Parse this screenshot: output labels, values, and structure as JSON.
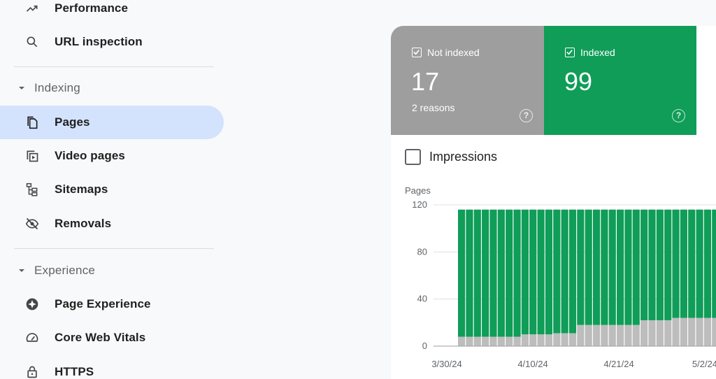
{
  "sidebar": {
    "items": [
      {
        "label": "Performance",
        "icon": "trending-up-icon"
      },
      {
        "label": "URL inspection",
        "icon": "search-icon"
      }
    ],
    "sections": [
      {
        "label": "Indexing",
        "items": [
          {
            "label": "Pages",
            "icon": "pages-icon",
            "active": true
          },
          {
            "label": "Video pages",
            "icon": "video-pages-icon"
          },
          {
            "label": "Sitemaps",
            "icon": "sitemap-icon"
          },
          {
            "label": "Removals",
            "icon": "eye-off-icon"
          }
        ]
      },
      {
        "label": "Experience",
        "items": [
          {
            "label": "Page Experience",
            "icon": "page-experience-icon"
          },
          {
            "label": "Core Web Vitals",
            "icon": "speedometer-icon"
          },
          {
            "label": "HTTPS",
            "icon": "lock-icon"
          }
        ]
      }
    ]
  },
  "cards": {
    "not_indexed": {
      "title": "Not indexed",
      "value": "17",
      "sub": "2 reasons",
      "color": "#9e9e9e",
      "help": "?"
    },
    "indexed": {
      "title": "Indexed",
      "value": "99",
      "color": "#0f9d58",
      "help": "?"
    }
  },
  "impressions": {
    "label": "Impressions",
    "checked": false
  },
  "chart_data": {
    "type": "bar",
    "stacked": true,
    "ylabel": "Pages",
    "ylim": [
      0,
      120
    ],
    "yticks": [
      "120",
      "80",
      "40",
      "0"
    ],
    "xtick_labels": [
      "3/30/24",
      "4/10/24",
      "4/21/24",
      "5/2/24"
    ],
    "grid": true,
    "series": [
      {
        "name": "Not indexed",
        "color": "#bdbdbd",
        "values": [
          0,
          0,
          0,
          0,
          0,
          8,
          8,
          8,
          8,
          8,
          8,
          8,
          8,
          10,
          10,
          10,
          10,
          11,
          11,
          11,
          18,
          18,
          18,
          18,
          18,
          18,
          18,
          18,
          22,
          22,
          22,
          22,
          24,
          24,
          24,
          24,
          24,
          24,
          24,
          24,
          24,
          24,
          24,
          24
        ]
      },
      {
        "name": "Indexed",
        "color": "#0f9d58",
        "values": [
          0,
          0,
          0,
          0,
          0,
          108,
          108,
          108,
          108,
          108,
          108,
          108,
          108,
          106,
          106,
          106,
          106,
          105,
          105,
          105,
          98,
          98,
          98,
          98,
          98,
          98,
          98,
          98,
          94,
          94,
          94,
          94,
          92,
          92,
          92,
          92,
          92,
          92,
          92,
          92,
          92,
          92,
          92,
          92
        ]
      }
    ]
  }
}
